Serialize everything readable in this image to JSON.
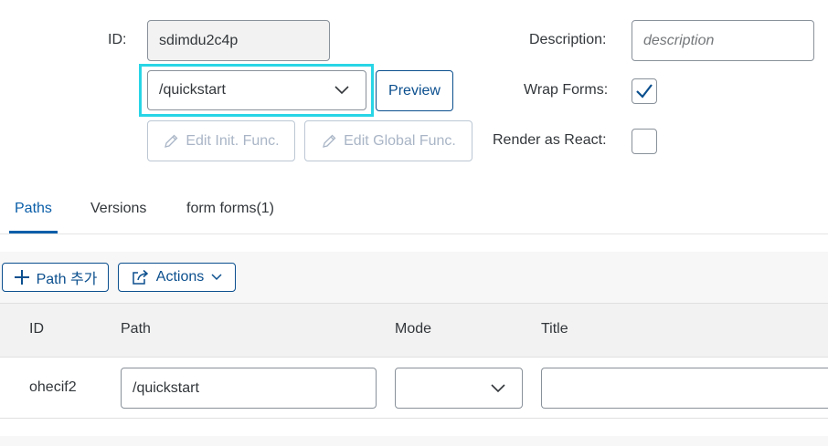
{
  "form": {
    "id_label": "ID:",
    "id_value": "sdimdu2c4p",
    "path_select_value": "/quickstart",
    "preview_label": "Preview",
    "edit_init_label": "Edit Init. Func.",
    "edit_global_label": "Edit Global Func.",
    "description_label": "Description:",
    "description_placeholder": "description",
    "wrap_forms_label": "Wrap Forms:",
    "wrap_forms_checked": true,
    "render_react_label": "Render as React:",
    "render_react_checked": false
  },
  "tabs": [
    {
      "label": "Paths",
      "active": true
    },
    {
      "label": "Versions",
      "active": false
    },
    {
      "label": "form forms(1)",
      "active": false
    }
  ],
  "toolbar": {
    "add_path_label": "Path 추가",
    "actions_label": "Actions"
  },
  "table": {
    "columns": [
      "ID",
      "Path",
      "Mode",
      "Title"
    ],
    "rows": [
      {
        "id": "ohecif2",
        "path": "/quickstart",
        "mode": "",
        "title": ""
      }
    ]
  },
  "icons": {
    "dropdown": "chevron-down-icon",
    "edit": "pencil-icon",
    "add": "plus-icon",
    "actions": "share-icon",
    "check": "checkmark-icon"
  },
  "colors": {
    "accent": "#0a6ed1",
    "focus": "#28d5e6",
    "disabled": "#a9b5c6"
  }
}
